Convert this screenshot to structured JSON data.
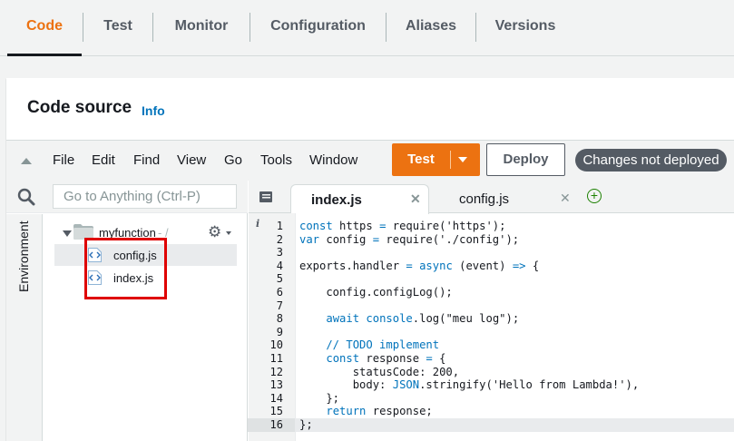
{
  "tabs": [
    {
      "label": "Code",
      "active": true
    },
    {
      "label": "Test"
    },
    {
      "label": "Monitor"
    },
    {
      "label": "Configuration"
    },
    {
      "label": "Aliases"
    },
    {
      "label": "Versions"
    }
  ],
  "panel": {
    "title": "Code source",
    "info": "Info"
  },
  "menu": {
    "items": [
      "File",
      "Edit",
      "Find",
      "View",
      "Go",
      "Tools",
      "Window"
    ],
    "test_label": "Test",
    "deploy_label": "Deploy",
    "status_badge": "Changes not deployed"
  },
  "sidebar": {
    "search_placeholder": "Go to Anything (Ctrl-P)",
    "environment_label": "Environment",
    "folder_name": "myfunction",
    "folder_path": "- /",
    "files": [
      "config.js",
      "index.js"
    ]
  },
  "editor": {
    "tabs": [
      {
        "label": "index.js",
        "active": true
      },
      {
        "label": "config.js"
      }
    ],
    "current_line": 16,
    "lines": [
      [
        [
          "kw",
          "const"
        ],
        [
          "t",
          " https "
        ],
        [
          "op",
          "="
        ],
        [
          "t",
          " require('https');"
        ]
      ],
      [
        [
          "kw",
          "var"
        ],
        [
          "t",
          " config "
        ],
        [
          "op",
          "="
        ],
        [
          "t",
          " require('./config');"
        ]
      ],
      [
        [
          "t",
          ""
        ]
      ],
      [
        [
          "t",
          "exports.handler "
        ],
        [
          "op",
          "="
        ],
        [
          "t",
          " "
        ],
        [
          "kw",
          "async"
        ],
        [
          "t",
          " (event) "
        ],
        [
          "op",
          "=>"
        ],
        [
          "t",
          " {"
        ]
      ],
      [
        [
          "t",
          ""
        ]
      ],
      [
        [
          "t",
          "    config.configLog();"
        ]
      ],
      [
        [
          "t",
          ""
        ]
      ],
      [
        [
          "t",
          "    "
        ],
        [
          "kw",
          "await"
        ],
        [
          "t",
          " "
        ],
        [
          "kw",
          "console"
        ],
        [
          "t",
          ".log(\"meu log\");"
        ]
      ],
      [
        [
          "t",
          ""
        ]
      ],
      [
        [
          "cm",
          "    // TODO implement"
        ]
      ],
      [
        [
          "t",
          "    "
        ],
        [
          "kw",
          "const"
        ],
        [
          "t",
          " response "
        ],
        [
          "op",
          "="
        ],
        [
          "t",
          " {"
        ]
      ],
      [
        [
          "t",
          "        statusCode: 200,"
        ]
      ],
      [
        [
          "t",
          "        body: "
        ],
        [
          "kw",
          "JSON"
        ],
        [
          "t",
          ".stringify('Hello from Lambda!'),"
        ]
      ],
      [
        [
          "t",
          "    };"
        ]
      ],
      [
        [
          "t",
          "    "
        ],
        [
          "kw",
          "return"
        ],
        [
          "t",
          " response;"
        ]
      ],
      [
        [
          "t",
          "};"
        ]
      ]
    ]
  },
  "colors": {
    "accent": "#ec7211",
    "link": "#0073bb",
    "highlight_box": "#df0000"
  }
}
